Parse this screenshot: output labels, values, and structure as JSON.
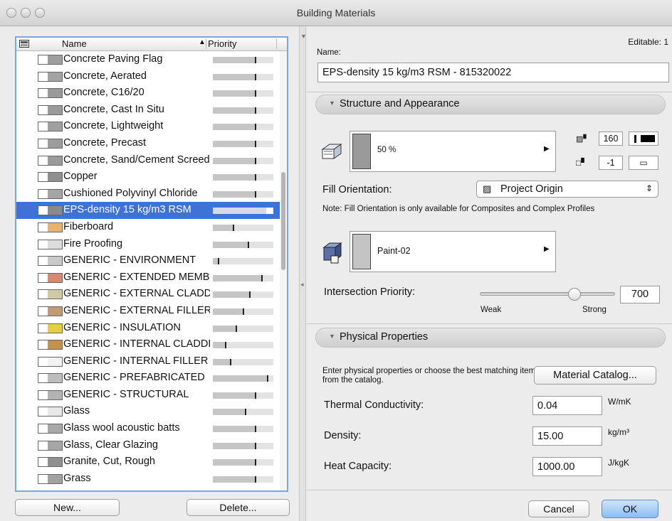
{
  "window": {
    "title": "Building Materials"
  },
  "list": {
    "header": {
      "name": "Name",
      "priority": "Priority",
      "sort_indicator": "▲"
    },
    "items": [
      {
        "name": "Concrete Paving Flag",
        "swatch": "#9e9e9e",
        "priority": 0.72,
        "selected": false
      },
      {
        "name": "Concrete, Aerated",
        "swatch": "#a3a3a3",
        "priority": 0.72,
        "selected": false
      },
      {
        "name": "Concrete, C16/20",
        "swatch": "#999999",
        "priority": 0.72,
        "selected": false
      },
      {
        "name": "Concrete, Cast In Situ",
        "swatch": "#9a9a9a",
        "priority": 0.72,
        "selected": false
      },
      {
        "name": "Concrete, Lightweight",
        "swatch": "#a0a0a0",
        "priority": 0.72,
        "selected": false
      },
      {
        "name": "Concrete, Precast",
        "swatch": "#9d9d9d",
        "priority": 0.72,
        "selected": false
      },
      {
        "name": "Concrete, Sand/Cement Screed",
        "swatch": "#9b9b9b",
        "priority": 0.72,
        "selected": false
      },
      {
        "name": "Copper",
        "swatch": "#8f8f8f",
        "priority": 0.72,
        "selected": false
      },
      {
        "name": "Cushioned Polyvinyl Chloride",
        "swatch": "#a5a5a5",
        "priority": 0.72,
        "selected": false
      },
      {
        "name": "EPS-density 15 kg/m3 RSM",
        "swatch": "#8a8a8a",
        "priority": 0.9,
        "selected": true
      },
      {
        "name": "Fiberboard",
        "swatch": "#e7b56c",
        "priority": 0.35,
        "selected": false
      },
      {
        "name": "Fire Proofing",
        "swatch": "#dcdcdc",
        "priority": 0.6,
        "selected": false
      },
      {
        "name": "GENERIC - ENVIRONMENT",
        "swatch": "#c9c9c9",
        "priority": 0.1,
        "selected": false
      },
      {
        "name": "GENERIC - EXTENDED MEMBRANE",
        "swatch": "#d98770",
        "priority": 0.82,
        "selected": false
      },
      {
        "name": "GENERIC - EXTERNAL CLADDING",
        "swatch": "#cfc9a6",
        "priority": 0.62,
        "selected": false
      },
      {
        "name": "GENERIC - EXTERNAL FILLER",
        "swatch": "#c29a78",
        "priority": 0.52,
        "selected": false
      },
      {
        "name": "GENERIC - INSULATION",
        "swatch": "#e6cf3d",
        "priority": 0.4,
        "selected": false
      },
      {
        "name": "GENERIC - INTERNAL CLADDING",
        "swatch": "#c5914f",
        "priority": 0.22,
        "selected": false
      },
      {
        "name": "GENERIC - INTERNAL FILLER",
        "swatch": "#f2f2f2",
        "priority": 0.3,
        "selected": false
      },
      {
        "name": "GENERIC - PREFABRICATED",
        "swatch": "#bdbdbd",
        "priority": 0.92,
        "selected": false
      },
      {
        "name": "GENERIC - STRUCTURAL",
        "swatch": "#b3b3b3",
        "priority": 0.72,
        "selected": false
      },
      {
        "name": "Glass",
        "swatch": "#e8e8e8",
        "priority": 0.55,
        "selected": false
      },
      {
        "name": "Glass wool acoustic batts",
        "swatch": "#a8a8a8",
        "priority": 0.72,
        "selected": false
      },
      {
        "name": "Glass, Clear Glazing",
        "swatch": "#a6a6a6",
        "priority": 0.72,
        "selected": false
      },
      {
        "name": "Granite, Cut, Rough",
        "swatch": "#909090",
        "priority": 0.72,
        "selected": false
      },
      {
        "name": "Grass",
        "swatch": "#a2a2a2",
        "priority": 0.72,
        "selected": false
      }
    ],
    "new_label": "New...",
    "delete_label": "Delete..."
  },
  "editor": {
    "editable_label": "Editable: 1",
    "name_label": "Name:",
    "name_value": "EPS-density 15 kg/m3 RSM - 815320022",
    "structure": {
      "title": "Structure and Appearance",
      "fill_percent": "50 %",
      "pen_cut_fill": "160",
      "pen_background": "-1",
      "fill_orientation_label": "Fill Orientation:",
      "fill_orientation_value": "Project Origin",
      "note": "Note: Fill Orientation is only available for Composites and Complex Profiles",
      "surface_value": "Paint-02",
      "intersection_label": "Intersection Priority:",
      "intersection_value": "700",
      "intersection_fraction": 0.72,
      "weak_label": "Weak",
      "strong_label": "Strong"
    },
    "physical": {
      "title": "Physical Properties",
      "intro": "Enter physical properties or choose the best matching item from the catalog.",
      "catalog_button": "Material Catalog...",
      "thermal_label": "Thermal Conductivity:",
      "thermal_value": "0.04",
      "thermal_unit": "W/mK",
      "density_label": "Density:",
      "density_value": "15.00",
      "density_unit": "kg/m³",
      "heat_label": "Heat Capacity:",
      "heat_value": "1000.00",
      "heat_unit": "J/kgK"
    },
    "cancel_label": "Cancel",
    "ok_label": "OK"
  },
  "colors": {
    "accent": "#3e72d6",
    "ok_button": "#a9cdf6"
  }
}
